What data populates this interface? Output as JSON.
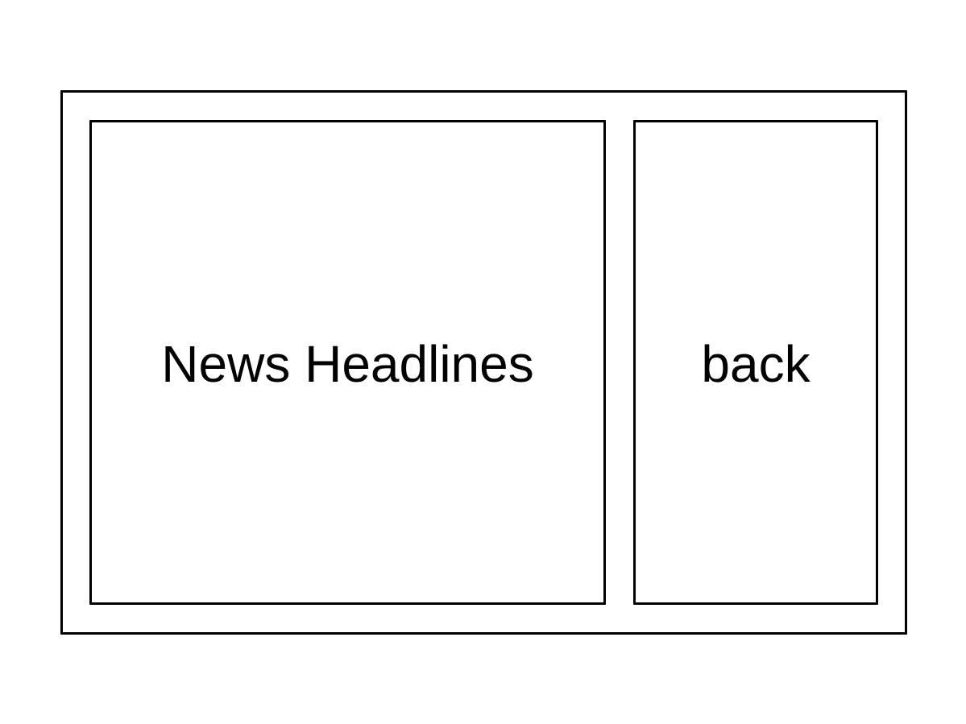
{
  "panels": {
    "headlines": {
      "label": "News Headlines"
    },
    "back": {
      "label": "back"
    }
  },
  "colors": {
    "stroke": "#000000",
    "background": "#ffffff"
  }
}
